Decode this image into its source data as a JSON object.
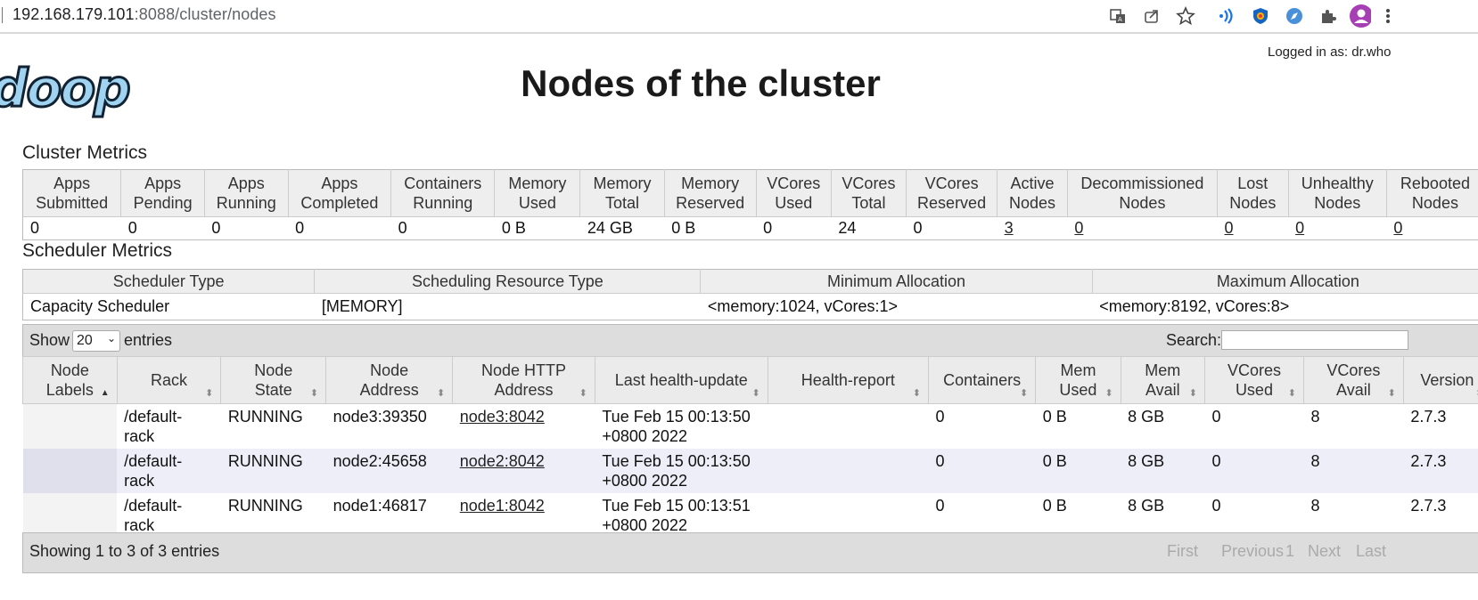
{
  "browser": {
    "url_host": "192.168.179.101",
    "url_path": ":8088/cluster/nodes"
  },
  "header": {
    "logo_text": "doop",
    "logged_in": "Logged in as: dr.who",
    "title": "Nodes of the cluster"
  },
  "cluster_metrics": {
    "heading": "Cluster Metrics",
    "headers": [
      [
        "Apps",
        "Submitted"
      ],
      [
        "Apps",
        "Pending"
      ],
      [
        "Apps",
        "Running"
      ],
      [
        "Apps",
        "Completed"
      ],
      [
        "Containers",
        "Running"
      ],
      [
        "Memory",
        "Used"
      ],
      [
        "Memory",
        "Total"
      ],
      [
        "Memory",
        "Reserved"
      ],
      [
        "VCores",
        "Used"
      ],
      [
        "VCores",
        "Total"
      ],
      [
        "VCores",
        "Reserved"
      ],
      [
        "Active",
        "Nodes"
      ],
      [
        "Decommissioned",
        "Nodes"
      ],
      [
        "Lost",
        "Nodes"
      ],
      [
        "Unhealthy",
        "Nodes"
      ],
      [
        "Rebooted",
        "Nodes"
      ]
    ],
    "values": [
      "0",
      "0",
      "0",
      "0",
      "0",
      "0 B",
      "24 GB",
      "0 B",
      "0",
      "24",
      "0",
      "3",
      "0",
      "0",
      "0",
      "0"
    ]
  },
  "scheduler_metrics": {
    "heading": "Scheduler Metrics",
    "headers": [
      "Scheduler Type",
      "Scheduling Resource Type",
      "Minimum Allocation",
      "Maximum Allocation"
    ],
    "values": [
      "Capacity Scheduler",
      "[MEMORY]",
      "<memory:1024, vCores:1>",
      "<memory:8192, vCores:8>"
    ]
  },
  "nodes_table": {
    "show_label": "Show",
    "page_size": "20",
    "entries_label": "entries",
    "search_label": "Search:",
    "headers": [
      [
        "Node",
        "Labels"
      ],
      [
        "Rack"
      ],
      [
        "Node",
        "State"
      ],
      [
        "Node",
        "Address"
      ],
      [
        "Node HTTP",
        "Address"
      ],
      [
        "Last health-update"
      ],
      [
        "Health-report"
      ],
      [
        "Containers"
      ],
      [
        "Mem",
        "Used"
      ],
      [
        "Mem",
        "Avail"
      ],
      [
        "VCores",
        "Used"
      ],
      [
        "VCores",
        "Avail"
      ],
      [
        "Version"
      ]
    ],
    "rows": [
      {
        "labels": "",
        "rack": [
          "/default-",
          "rack"
        ],
        "state": "RUNNING",
        "address": "node3:39350",
        "http": "node3:8042",
        "health": [
          "Tue Feb 15 00:13:50",
          "+0800 2022"
        ],
        "report": "",
        "containers": "0",
        "mem_used": "0 B",
        "mem_avail": "8 GB",
        "vc_used": "0",
        "vc_avail": "8",
        "version": "2.7.3"
      },
      {
        "labels": "",
        "rack": [
          "/default-",
          "rack"
        ],
        "state": "RUNNING",
        "address": "node2:45658",
        "http": "node2:8042",
        "health": [
          "Tue Feb 15 00:13:50",
          "+0800 2022"
        ],
        "report": "",
        "containers": "0",
        "mem_used": "0 B",
        "mem_avail": "8 GB",
        "vc_used": "0",
        "vc_avail": "8",
        "version": "2.7.3"
      },
      {
        "labels": "",
        "rack": [
          "/default-",
          "rack"
        ],
        "state": "RUNNING",
        "address": "node1:46817",
        "http": "node1:8042",
        "health": [
          "Tue Feb 15 00:13:51",
          "+0800 2022"
        ],
        "report": "",
        "containers": "0",
        "mem_used": "0 B",
        "mem_avail": "8 GB",
        "vc_used": "0",
        "vc_avail": "8",
        "version": "2.7.3"
      }
    ],
    "footer_info": "Showing 1 to 3 of 3 entries",
    "pagination": {
      "first": "First",
      "previous": "Previous",
      "page": "1",
      "next": "Next",
      "last": "Last"
    }
  }
}
